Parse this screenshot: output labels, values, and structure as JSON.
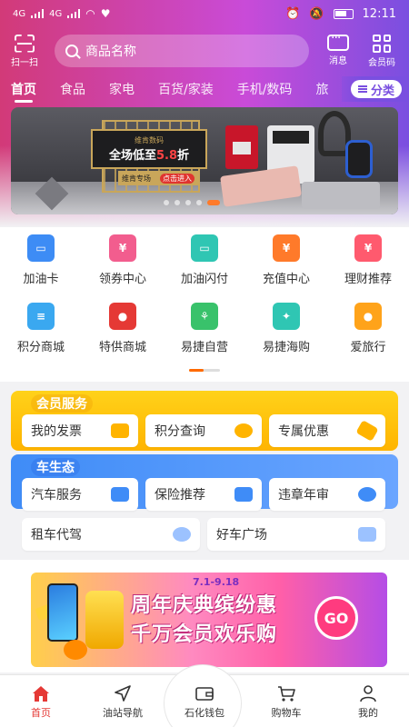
{
  "status": {
    "time": "12:11",
    "network": [
      "4G",
      "4G"
    ]
  },
  "header": {
    "scan_label": "扫一扫",
    "search_placeholder": "商品名称",
    "messages_label": "消息",
    "member_code_label": "会员码"
  },
  "categories": {
    "items": [
      "首页",
      "食品",
      "家电",
      "百货/家装",
      "手机/数码",
      "旅"
    ],
    "active_index": 0,
    "category_button": "分类"
  },
  "banner": {
    "brand": "维肯数码",
    "headline": "全场低至",
    "discount": "5.8",
    "suffix": "折",
    "tag_left": "维肯专场",
    "tag_right": "点击进入",
    "slides": 5,
    "active_slide": 4
  },
  "quick_icons": [
    {
      "label": "加油卡",
      "icon": "gas-card-icon",
      "color": "#3d8cf5"
    },
    {
      "label": "领券中心",
      "icon": "coupon-icon",
      "color": "#f25d8e"
    },
    {
      "label": "加油闪付",
      "icon": "quick-pay-icon",
      "color": "#2fc6b3"
    },
    {
      "label": "充值中心",
      "icon": "recharge-icon",
      "color": "#ff7a2a"
    },
    {
      "label": "理财推荐",
      "icon": "finance-icon",
      "color": "#ff5a6e"
    },
    {
      "label": "积分商城",
      "icon": "points-mall-icon",
      "color": "#3aa8f0"
    },
    {
      "label": "特供商城",
      "icon": "special-mall-icon",
      "color": "#e53935"
    },
    {
      "label": "易捷自营",
      "icon": "yijie-self-icon",
      "color": "#39c26b"
    },
    {
      "label": "易捷海购",
      "icon": "yijie-global-icon",
      "color": "#2fc6b3"
    },
    {
      "label": "爱旅行",
      "icon": "travel-icon",
      "color": "#ffa31a"
    }
  ],
  "member_service": {
    "title": "会员服务",
    "items": [
      "我的发票",
      "积分查询",
      "专属优惠"
    ],
    "icon_colors": [
      "#ffb400",
      "#ffb400",
      "#ffb400"
    ]
  },
  "car_ecosystem": {
    "title": "车生态",
    "items": [
      "汽车服务",
      "保险推荐",
      "违章年审",
      "租车代驾",
      "好车广场"
    ],
    "icon_colors": [
      "#3f8cf7",
      "#3f8cf7",
      "#3f8cf7",
      "#3f8cf7",
      "#3f8cf7"
    ]
  },
  "promo": {
    "date": "7.1-9.18",
    "line1": "周年庆典缤纷惠",
    "line2": "千万会员欢乐购",
    "go": "GO"
  },
  "bottom_nav": {
    "items": [
      "首页",
      "油站导航",
      "石化钱包",
      "购物车",
      "我的"
    ],
    "active_index": 0,
    "active_color": "#e53935"
  }
}
